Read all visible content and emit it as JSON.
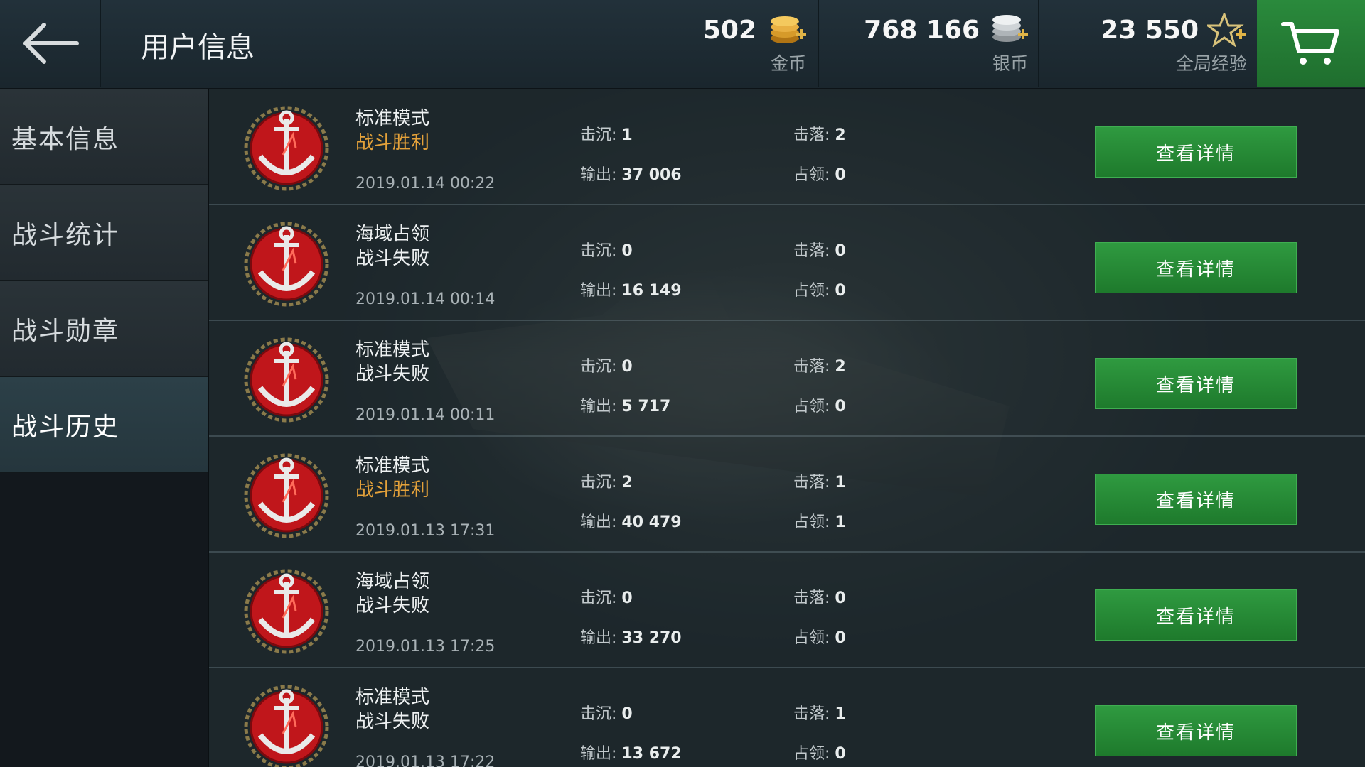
{
  "header": {
    "title": "用户信息",
    "gold": {
      "value": "502",
      "label": "金币"
    },
    "silver": {
      "value": "768 166",
      "label": "银币"
    },
    "exp": {
      "value": "23 550",
      "label": "全局经验"
    }
  },
  "sidebar": {
    "items": [
      {
        "label": "基本信息",
        "active": false
      },
      {
        "label": "战斗统计",
        "active": false
      },
      {
        "label": "战斗勋章",
        "active": false
      },
      {
        "label": "战斗历史",
        "active": true
      }
    ]
  },
  "battles": [
    {
      "mode": "标准模式",
      "result": "战斗胜利",
      "win": true,
      "time": "2019.01.14 00:22",
      "sunk_label": "击沉:",
      "sunk": "1",
      "shot_label": "击落:",
      "shot": "2",
      "dmg_label": "输出:",
      "dmg": "37 006",
      "cap_label": "占领:",
      "cap": "0",
      "button": "查看详情"
    },
    {
      "mode": "海域占领",
      "result": "战斗失败",
      "win": false,
      "time": "2019.01.14 00:14",
      "sunk_label": "击沉:",
      "sunk": "0",
      "shot_label": "击落:",
      "shot": "0",
      "dmg_label": "输出:",
      "dmg": "16 149",
      "cap_label": "占领:",
      "cap": "0",
      "button": "查看详情"
    },
    {
      "mode": "标准模式",
      "result": "战斗失败",
      "win": false,
      "time": "2019.01.14 00:11",
      "sunk_label": "击沉:",
      "sunk": "0",
      "shot_label": "击落:",
      "shot": "2",
      "dmg_label": "输出:",
      "dmg": "5 717",
      "cap_label": "占领:",
      "cap": "0",
      "button": "查看详情"
    },
    {
      "mode": "标准模式",
      "result": "战斗胜利",
      "win": true,
      "time": "2019.01.13 17:31",
      "sunk_label": "击沉:",
      "sunk": "2",
      "shot_label": "击落:",
      "shot": "1",
      "dmg_label": "输出:",
      "dmg": "40 479",
      "cap_label": "占领:",
      "cap": "1",
      "button": "查看详情"
    },
    {
      "mode": "海域占领",
      "result": "战斗失败",
      "win": false,
      "time": "2019.01.13 17:25",
      "sunk_label": "击沉:",
      "sunk": "0",
      "shot_label": "击落:",
      "shot": "0",
      "dmg_label": "输出:",
      "dmg": "33 270",
      "cap_label": "占领:",
      "cap": "0",
      "button": "查看详情"
    },
    {
      "mode": "标准模式",
      "result": "战斗失败",
      "win": false,
      "time": "2019.01.13 17:22",
      "sunk_label": "击沉:",
      "sunk": "0",
      "shot_label": "击落:",
      "shot": "1",
      "dmg_label": "输出:",
      "dmg": "13 672",
      "cap_label": "占领:",
      "cap": "0",
      "button": "查看详情"
    }
  ],
  "colors": {
    "win": "#e5a23a",
    "button": "#2a8a3c",
    "medal": "#c0161b"
  },
  "icons": [
    "back-arrow-icon",
    "gold-coins-icon",
    "silver-coins-icon",
    "star-exp-icon",
    "cart-icon",
    "anchor-medal-icon"
  ]
}
